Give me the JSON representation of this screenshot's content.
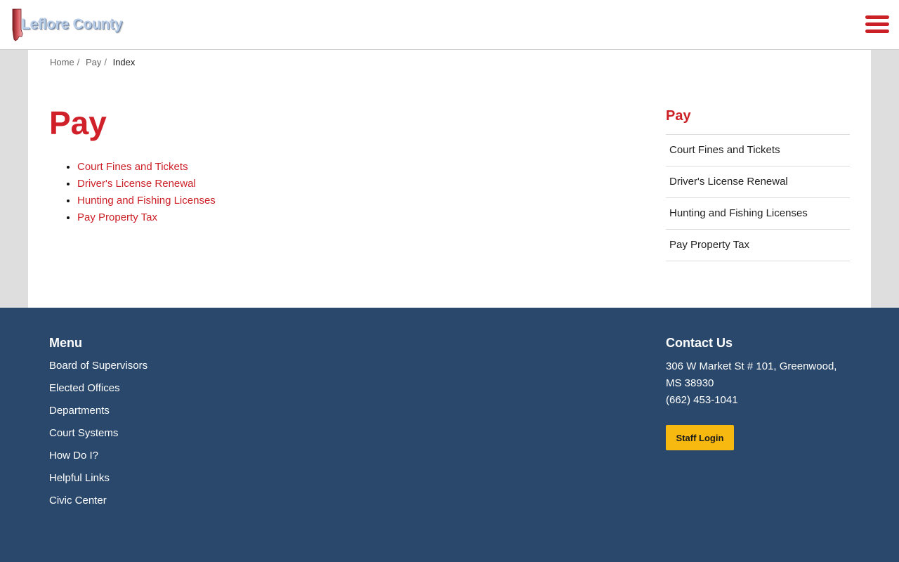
{
  "header": {
    "logo_text": "Leflore County",
    "menu_icon": "hamburger-menu-icon"
  },
  "breadcrumb": {
    "items": [
      "Home",
      "Pay"
    ],
    "current": "Index"
  },
  "page": {
    "title": "Pay",
    "links": [
      "Court Fines and Tickets",
      "Driver's License Renewal",
      "Hunting and Fishing Licenses",
      "Pay Property Tax"
    ]
  },
  "sidebar": {
    "title": "Pay",
    "items": [
      "Court Fines and Tickets",
      "Driver's License Renewal",
      "Hunting and Fishing Licenses",
      "Pay Property Tax"
    ]
  },
  "footer": {
    "menu_heading": "Menu",
    "menu_items": [
      "Board of Supervisors",
      "Elected Offices",
      "Departments",
      "Court Systems",
      "How Do I?",
      "Helpful Links",
      "Civic Center"
    ],
    "contact_heading": "Contact Us",
    "address": "306 W Market St # 101, Greenwood, MS 38930",
    "phone": "(662) 453-1041",
    "staff_login_label": "Staff Login"
  },
  "colors": {
    "accent_red": "#cc2027",
    "footer_navy": "#29486b",
    "login_yellow": "#f7b90f"
  }
}
